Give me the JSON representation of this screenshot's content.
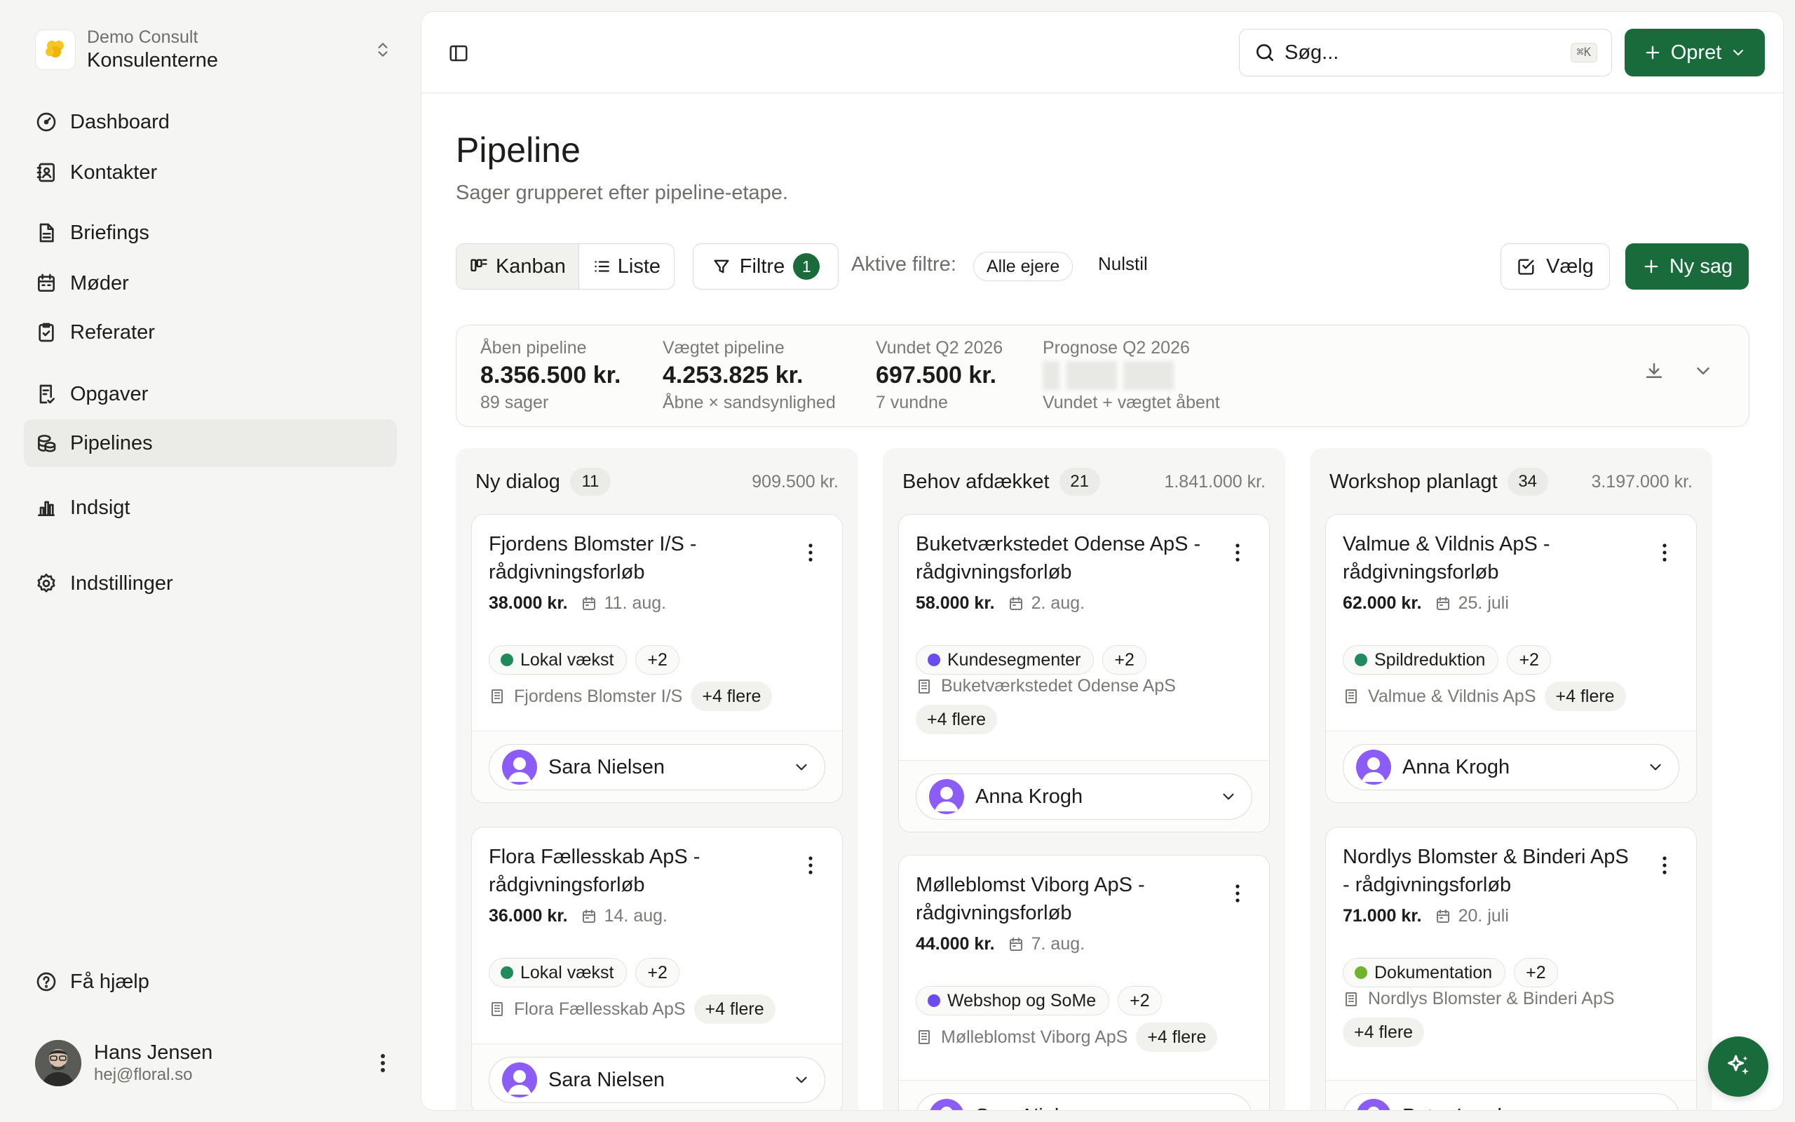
{
  "workspace": {
    "org": "Demo Consult",
    "name": "Konsulenterne"
  },
  "nav": {
    "dashboard": "Dashboard",
    "contacts": "Kontakter",
    "briefings": "Briefings",
    "meetings": "Møder",
    "minutes": "Referater",
    "tasks": "Opgaver",
    "pipelines": "Pipelines",
    "insight": "Indsigt",
    "settings": "Indstillinger",
    "help": "Få hjælp"
  },
  "user": {
    "name": "Hans Jensen",
    "email": "hej@floral.so"
  },
  "topbar": {
    "search_placeholder": "Søg...",
    "search_shortcut": "⌘K",
    "create_label": "Opret"
  },
  "page": {
    "title": "Pipeline",
    "subtitle": "Sager grupperet efter pipeline-etape."
  },
  "toolbar": {
    "view_kanban": "Kanban",
    "view_list": "Liste",
    "filters_label": "Filtre",
    "filters_count": "1",
    "active_filters_label": "Aktive filtre:",
    "owner_chip": "Alle ejere",
    "reset_label": "Nulstil",
    "choose_label": "Vælg",
    "new_case_label": "Ny sag"
  },
  "stats": [
    {
      "label": "Åben pipeline",
      "value": "8.356.500 kr.",
      "note": "89 sager"
    },
    {
      "label": "Vægtet pipeline",
      "value": "4.253.825 kr.",
      "note": "Åbne × sandsynlighed"
    },
    {
      "label": "Vundet Q2 2026",
      "value": "697.500 kr.",
      "note": "7 vundne"
    },
    {
      "label": "Prognose Q2 2026",
      "value": "",
      "note": "Vundet + vægtet åbent"
    }
  ],
  "colors": {
    "accent": "#1a6b3c",
    "owner_avatar": "#8b5cf6"
  },
  "columns": [
    {
      "title": "Ny dialog",
      "count": "11",
      "sum": "909.500 kr.",
      "cards": [
        {
          "title": "Fjordens Blomster I/S - rådgivningsforløb",
          "amount": "38.000 kr.",
          "date": "11. aug.",
          "tag": "Lokal vækst",
          "tag_color": "#1f8a5b",
          "tag_more": "+2",
          "company": "Fjordens Blomster I/S",
          "company_more": "+4 flere",
          "owner": "Sara Nielsen"
        },
        {
          "title": "Flora Fællesskab ApS - rådgivningsforløb",
          "amount": "36.000 kr.",
          "date": "14. aug.",
          "tag": "Lokal vækst",
          "tag_color": "#1f8a5b",
          "tag_more": "+2",
          "company": "Flora Fællesskab ApS",
          "company_more": "+4 flere",
          "owner": "Sara Nielsen"
        }
      ]
    },
    {
      "title": "Behov afdækket",
      "count": "21",
      "sum": "1.841.000 kr.",
      "cards": [
        {
          "title": "Buketværkstedet Odense ApS - rådgivningsforløb",
          "amount": "58.000 kr.",
          "date": "2. aug.",
          "tag": "Kundesegmenter",
          "tag_color": "#6a4cf0",
          "tag_more": "+2",
          "company": "Buketværkstedet Odense ApS",
          "company_more": "+4 flere",
          "owner": "Anna Krogh"
        },
        {
          "title": "Mølleblomst Viborg ApS - rådgivningsforløb",
          "amount": "44.000 kr.",
          "date": "7. aug.",
          "tag": "Webshop og SoMe",
          "tag_color": "#6a4cf0",
          "tag_more": "+2",
          "company": "Mølleblomst Viborg ApS",
          "company_more": "+4 flere",
          "owner": "Sara Nielsen"
        }
      ]
    },
    {
      "title": "Workshop planlagt",
      "count": "34",
      "sum": "3.197.000 kr.",
      "cards": [
        {
          "title": "Valmue & Vildnis ApS - rådgivningsforløb",
          "amount": "62.000 kr.",
          "date": "25. juli",
          "tag": "Spildreduktion",
          "tag_color": "#1f8a5b",
          "tag_more": "+2",
          "company": "Valmue & Vildnis ApS",
          "company_more": "+4 flere",
          "owner": "Anna Krogh"
        },
        {
          "title": "Nordlys Blomster & Binderi ApS - rådgivningsforløb",
          "amount": "71.000 kr.",
          "date": "20. juli",
          "tag": "Dokumentation",
          "tag_color": "#6fb52c",
          "tag_more": "+2",
          "company": "Nordlys Blomster & Binderi ApS",
          "company_more": "+4 flere",
          "owner": "Peter Lund"
        }
      ]
    }
  ]
}
